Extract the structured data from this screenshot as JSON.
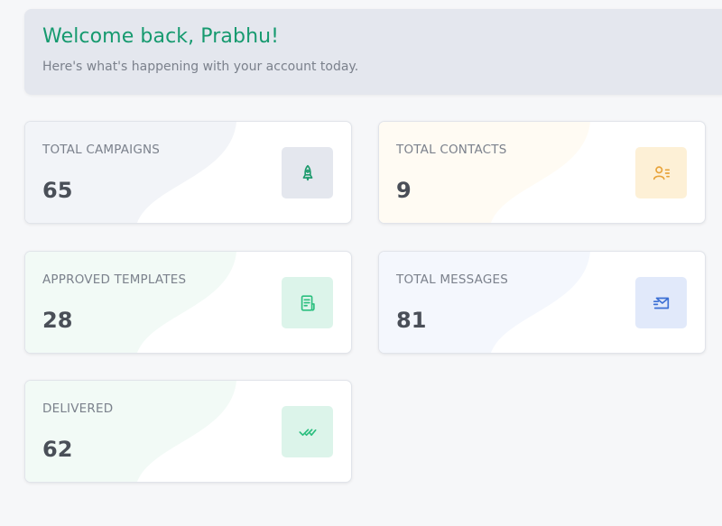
{
  "welcome": {
    "title": "Welcome back, Prabhu!",
    "subtitle": "Here's what's happening with your account today."
  },
  "stats": [
    {
      "label": "TOTAL CAMPAIGNS",
      "value": "65",
      "icon": "rocket-icon",
      "icon_bg": "#e4e7ee",
      "icon_color": "#1c9a6c",
      "blob_color": "#f2f4f8"
    },
    {
      "label": "TOTAL CONTACTS",
      "value": "9",
      "icon": "contacts-icon",
      "icon_bg": "#fdf0d6",
      "icon_color": "#e8a33a",
      "blob_color": "#fffbf3"
    },
    {
      "label": "APPROVED TEMPLATES",
      "value": "28",
      "icon": "template-icon",
      "icon_bg": "#dcf4ea",
      "icon_color": "#2bbf7f",
      "blob_color": "#f2faf6"
    },
    {
      "label": "TOTAL MESSAGES",
      "value": "81",
      "icon": "message-icon",
      "icon_bg": "#e1e9fa",
      "icon_color": "#3b6fd4",
      "blob_color": "#f4f7fd"
    },
    {
      "label": "DELIVERED",
      "value": "62",
      "icon": "double-check-icon",
      "icon_bg": "#dcf4ea",
      "icon_color": "#2bbf7f",
      "blob_color": "#f2faf6"
    }
  ]
}
